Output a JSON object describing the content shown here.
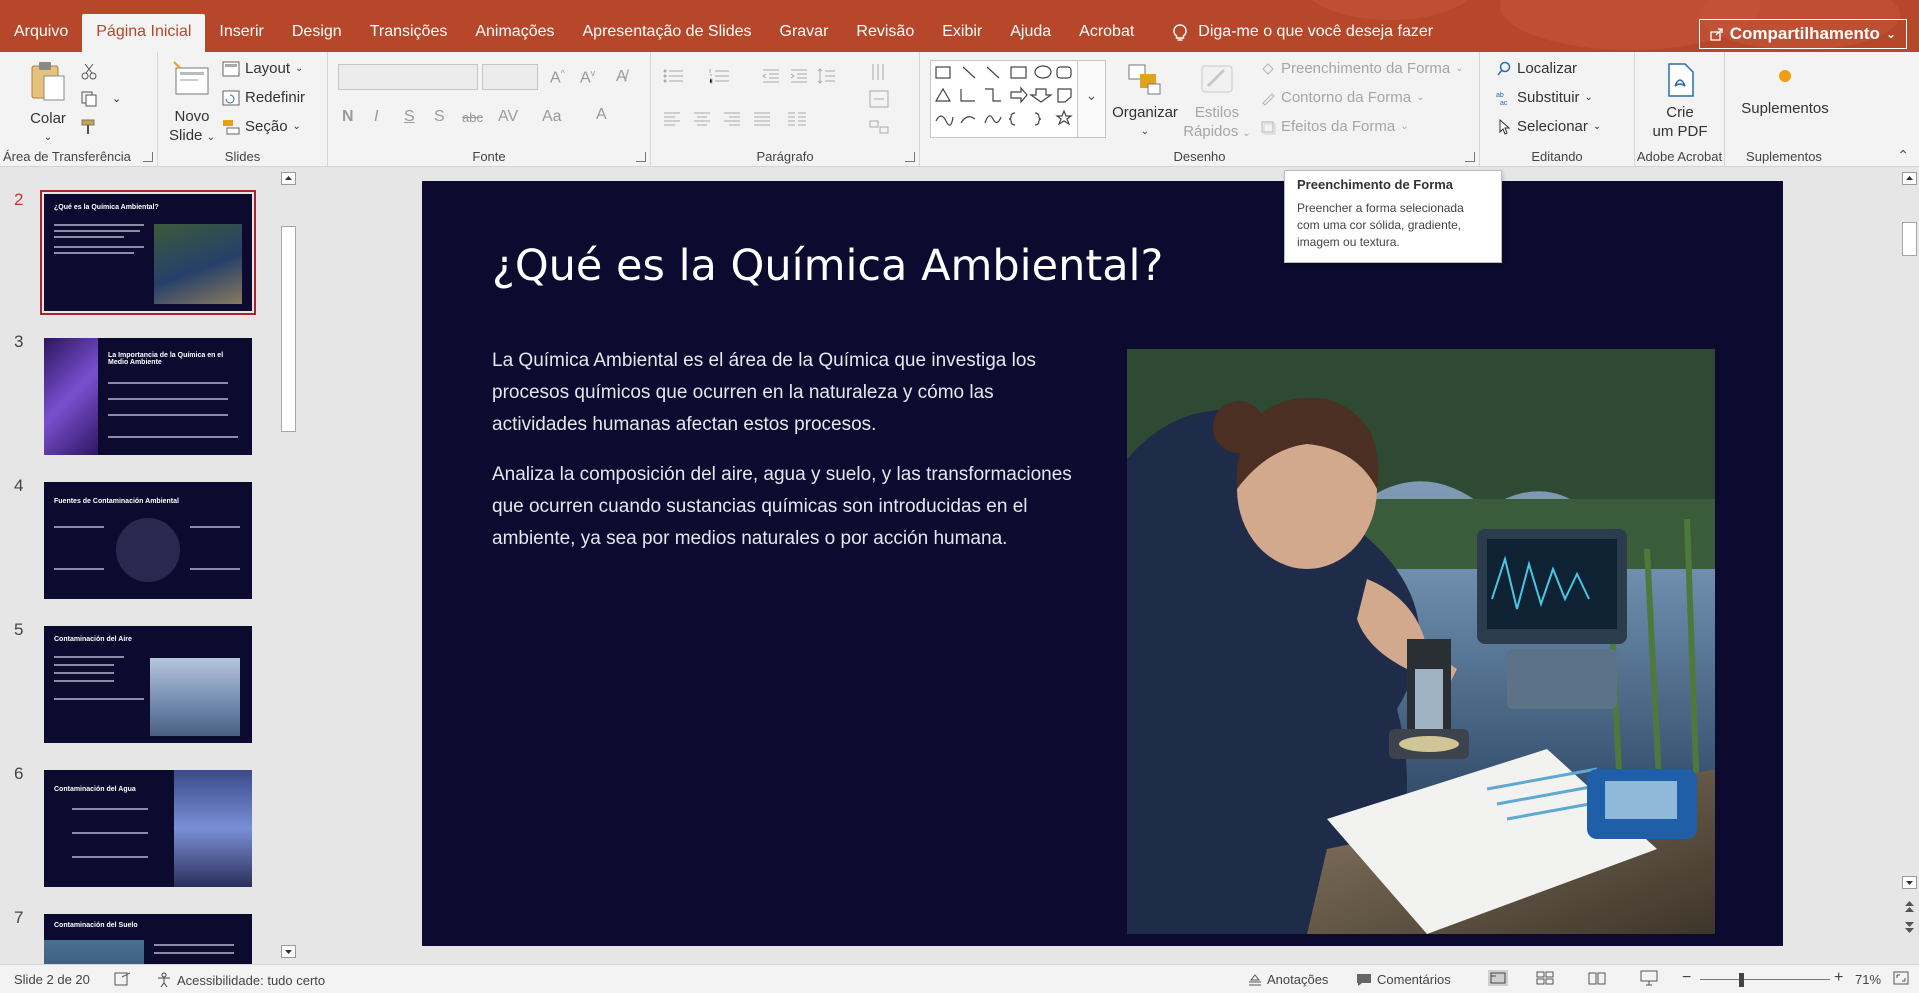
{
  "tabs": [
    "Arquivo",
    "Página Inicial",
    "Inserir",
    "Design",
    "Transições",
    "Animações",
    "Apresentação de Slides",
    "Gravar",
    "Revisão",
    "Exibir",
    "Ajuda",
    "Acrobat"
  ],
  "active_tab": "Página Inicial",
  "tell_me": "Diga-me o que você deseja fazer",
  "share_label": "Compartilhamento",
  "ribbon": {
    "clipboard": {
      "paste": "Colar",
      "label": "Área de Transferência"
    },
    "slides": {
      "new_slide_1": "Novo",
      "new_slide_2": "Slide",
      "layout": "Layout",
      "reset": "Redefinir",
      "section": "Seção",
      "label": "Slides"
    },
    "font": {
      "label": "Fonte"
    },
    "paragraph": {
      "label": "Parágrafo"
    },
    "drawing": {
      "arrange": "Organizar",
      "quick_styles_1": "Estilos",
      "quick_styles_2": "Rápidos",
      "shape_fill": "Preenchimento da Forma",
      "shape_outline": "Contorno da Forma",
      "shape_effects": "Efeitos da Forma",
      "label": "Desenho"
    },
    "editing": {
      "find": "Localizar",
      "replace": "Substituir",
      "select": "Selecionar",
      "label": "Editando"
    },
    "acrobat": {
      "create_pdf_1": "Crie",
      "create_pdf_2": "um PDF",
      "label": "Adobe Acrobat"
    },
    "addins": {
      "addins": "Suplementos",
      "label": "Suplementos"
    }
  },
  "tooltip": {
    "title": "Preenchimento de Forma",
    "body": "Preencher a forma selecionada com uma cor sólida, gradiente, imagem ou textura."
  },
  "thumbnails": [
    {
      "num": "2",
      "title": "¿Qué es la Química Ambiental?",
      "current": true
    },
    {
      "num": "3",
      "title": "La Importancia de la Química en el Medio Ambiente",
      "current": false
    },
    {
      "num": "4",
      "title": "Fuentes de Contaminación Ambiental",
      "current": false
    },
    {
      "num": "5",
      "title": "Contaminación del Aire",
      "current": false
    },
    {
      "num": "6",
      "title": "Contaminación del Agua",
      "current": false
    },
    {
      "num": "7",
      "title": "Contaminación del Suelo",
      "current": false
    }
  ],
  "slide": {
    "title": "¿Qué es la Química Ambiental?",
    "paragraph1": "La Química Ambiental es el área de la Química que investiga los procesos químicos que ocurren en la naturaleza y cómo las actividades humanas afectan estos procesos.",
    "paragraph2": "Analiza la composición del aire, agua y suelo, y las transformaciones que ocurren cuando sustancias químicas son introducidas en el ambiente, ya sea por medios naturales o por acción humana."
  },
  "status": {
    "slide_counter": "Slide 2 de 20",
    "accessibility": "Acessibilidade: tudo certo",
    "notes": "Anotações",
    "comments": "Comentários",
    "zoom": "71%"
  },
  "colors": {
    "accent": "#b7472a",
    "slide_bg": "#0c0a2e",
    "selection": "#a4262c"
  }
}
